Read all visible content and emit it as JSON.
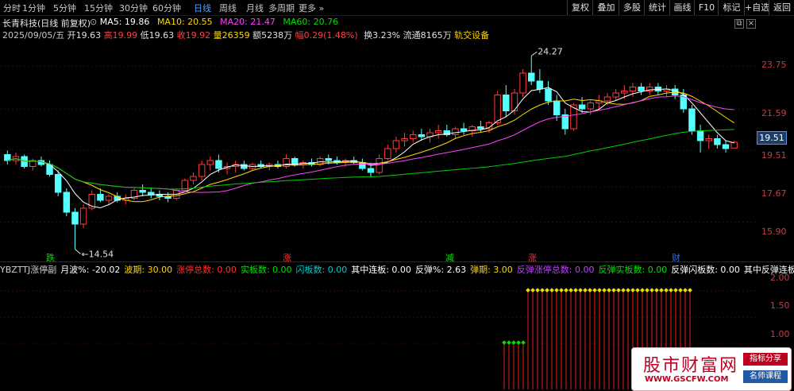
{
  "toolbar": {
    "periods": [
      "分时",
      "1分钟",
      "5分钟",
      "15分钟",
      "30分钟",
      "60分钟",
      "日线",
      "周线",
      "月线",
      "多周期",
      "更多 »"
    ],
    "active_period": "日线",
    "buttons": [
      "复权",
      "叠加",
      "多股",
      "统计",
      "画线",
      "F10",
      "标记",
      "+自选",
      "返回"
    ]
  },
  "stock": {
    "title": "长青科技(日线 前复权)",
    "ma5": "MA5: 19.86",
    "ma10": "MA10: 20.55",
    "ma20": "MA20: 21.47",
    "ma60": "MA60: 20.76",
    "date": "2025/09/05/五",
    "open": "开19.63",
    "high": "高19.99",
    "low": "低19.63",
    "close": "收19.92",
    "volume": "量26359",
    "amount": "额5238万",
    "change": "幅0.29(1.48%)",
    "turnover": "换3.23%",
    "float": "流通8165万",
    "sector": "轨交设备"
  },
  "axis": {
    "labels": [
      "23.75",
      "21.59",
      "19.51",
      "17.67",
      "15.90"
    ],
    "current_price": "19.51",
    "high_note": "24.27",
    "low_note": "14.54"
  },
  "signals": [
    "跌",
    "涨",
    "减",
    "涨",
    "财"
  ],
  "indicator": {
    "name": "YBZTTJ涨停副",
    "items": [
      {
        "label": "月波%: -20.02",
        "color": "#ffffff"
      },
      {
        "label": "波期: 30.00",
        "color": "#ffd700"
      },
      {
        "label": "涨停总数: 0.00",
        "color": "#ff3030"
      },
      {
        "label": "实板数: 0.00",
        "color": "#00e000"
      },
      {
        "label": "闪板数: 0.00",
        "color": "#00c8c8"
      },
      {
        "label": "其中连板: 0.00",
        "color": "#ffffff"
      },
      {
        "label": "反弹%: 2.63",
        "color": "#ffffff"
      },
      {
        "label": "弹期: 3.00",
        "color": "#ffd700"
      },
      {
        "label": "反弹涨停总数: 0.00",
        "color": "#c040ff"
      },
      {
        "label": "反弹实板数: 0.00",
        "color": "#00e000"
      },
      {
        "label": "反弹闪板数: 0.00",
        "color": "#ffffff"
      },
      {
        "label": "其中反弹连板:",
        "color": "#ffffff"
      }
    ],
    "axis": [
      "2.00",
      "1.50",
      "1.00"
    ]
  },
  "watermark": {
    "brand": "股市财富网",
    "url": "WWW.GSCFW.COM",
    "tag1": "指标分享",
    "tag2": "名师课程"
  },
  "chart_data": {
    "type": "candlestick",
    "ylim": [
      14.0,
      25.0
    ],
    "candles": [
      [
        19.3,
        19.5,
        18.8,
        19.0
      ],
      [
        19.0,
        19.4,
        18.8,
        19.2
      ],
      [
        19.2,
        19.3,
        18.6,
        18.7
      ],
      [
        18.7,
        19.1,
        18.5,
        19.0
      ],
      [
        19.0,
        19.2,
        18.7,
        18.8
      ],
      [
        18.8,
        19.0,
        18.2,
        18.3
      ],
      [
        18.3,
        18.5,
        17.2,
        17.4
      ],
      [
        17.4,
        17.6,
        16.2,
        16.4
      ],
      [
        16.4,
        16.6,
        14.54,
        15.8
      ],
      [
        15.8,
        16.8,
        15.6,
        16.6
      ],
      [
        16.6,
        17.5,
        16.5,
        17.3
      ],
      [
        17.3,
        17.6,
        16.9,
        17.0
      ],
      [
        17.0,
        17.3,
        16.8,
        17.2
      ],
      [
        17.2,
        17.4,
        16.9,
        17.0
      ],
      [
        17.0,
        17.3,
        16.8,
        17.1
      ],
      [
        17.1,
        17.6,
        17.0,
        17.5
      ],
      [
        17.5,
        17.8,
        17.2,
        17.4
      ],
      [
        17.4,
        17.6,
        17.1,
        17.3
      ],
      [
        17.3,
        17.5,
        17.0,
        17.2
      ],
      [
        17.2,
        17.4,
        16.9,
        17.1
      ],
      [
        17.1,
        17.6,
        17.0,
        17.5
      ],
      [
        17.5,
        18.1,
        17.4,
        18.0
      ],
      [
        18.0,
        18.4,
        17.8,
        18.2
      ],
      [
        18.2,
        19.0,
        18.0,
        18.8
      ],
      [
        18.8,
        19.2,
        18.5,
        19.0
      ],
      [
        19.0,
        19.3,
        18.4,
        18.6
      ],
      [
        18.6,
        18.9,
        18.3,
        18.7
      ],
      [
        18.7,
        19.0,
        18.4,
        18.8
      ],
      [
        18.8,
        19.0,
        18.5,
        18.6
      ],
      [
        18.6,
        18.9,
        18.5,
        18.8
      ],
      [
        18.8,
        19.0,
        18.6,
        18.7
      ],
      [
        18.7,
        18.9,
        18.5,
        18.8
      ],
      [
        18.8,
        19.0,
        18.6,
        18.7
      ],
      [
        18.7,
        19.3,
        18.6,
        19.1
      ],
      [
        19.1,
        19.2,
        18.7,
        18.8
      ],
      [
        18.8,
        19.0,
        18.6,
        18.9
      ],
      [
        18.9,
        19.1,
        18.7,
        18.8
      ],
      [
        18.8,
        19.2,
        18.7,
        19.1
      ],
      [
        19.1,
        19.3,
        18.8,
        19.0
      ],
      [
        19.0,
        19.2,
        18.8,
        18.9
      ],
      [
        18.9,
        19.1,
        18.7,
        19.0
      ],
      [
        19.0,
        19.2,
        18.8,
        18.9
      ],
      [
        18.9,
        19.1,
        18.5,
        18.6
      ],
      [
        18.6,
        18.9,
        18.2,
        18.4
      ],
      [
        18.4,
        19.3,
        18.3,
        19.1
      ],
      [
        19.1,
        19.8,
        19.0,
        19.6
      ],
      [
        19.6,
        20.2,
        19.4,
        20.0
      ],
      [
        20.0,
        20.4,
        19.7,
        20.1
      ],
      [
        20.1,
        20.5,
        19.9,
        20.3
      ],
      [
        20.3,
        20.6,
        20.0,
        20.2
      ],
      [
        20.2,
        20.6,
        19.9,
        20.4
      ],
      [
        20.4,
        20.8,
        20.1,
        20.5
      ],
      [
        20.5,
        20.8,
        20.2,
        20.3
      ],
      [
        20.3,
        20.7,
        20.1,
        20.6
      ],
      [
        20.6,
        20.9,
        20.3,
        20.5
      ],
      [
        20.5,
        20.8,
        20.2,
        20.7
      ],
      [
        20.7,
        21.0,
        20.4,
        20.6
      ],
      [
        20.6,
        21.0,
        20.4,
        20.9
      ],
      [
        20.9,
        22.5,
        20.8,
        22.3
      ],
      [
        22.3,
        22.8,
        21.2,
        21.5
      ],
      [
        21.5,
        22.6,
        21.3,
        22.4
      ],
      [
        22.4,
        23.6,
        22.2,
        23.4
      ],
      [
        23.4,
        24.27,
        22.8,
        23.0
      ],
      [
        23.0,
        23.6,
        22.4,
        22.6
      ],
      [
        22.6,
        23.0,
        21.8,
        22.0
      ],
      [
        22.0,
        22.3,
        21.0,
        21.3
      ],
      [
        21.3,
        21.6,
        20.3,
        20.6
      ],
      [
        20.6,
        21.9,
        20.5,
        21.8
      ],
      [
        21.8,
        22.2,
        21.4,
        21.6
      ],
      [
        21.6,
        22.0,
        21.3,
        21.9
      ],
      [
        21.9,
        22.3,
        21.6,
        22.0
      ],
      [
        22.0,
        22.4,
        21.8,
        22.2
      ],
      [
        22.2,
        22.6,
        22.0,
        22.4
      ],
      [
        22.4,
        22.8,
        22.1,
        22.5
      ],
      [
        22.5,
        22.9,
        22.2,
        22.7
      ],
      [
        22.7,
        22.9,
        22.3,
        22.5
      ],
      [
        22.5,
        22.9,
        22.3,
        22.7
      ],
      [
        22.7,
        22.9,
        22.3,
        22.5
      ],
      [
        22.5,
        22.8,
        22.2,
        22.6
      ],
      [
        22.6,
        22.8,
        22.1,
        22.3
      ],
      [
        22.3,
        22.6,
        21.4,
        21.6
      ],
      [
        21.6,
        21.8,
        20.3,
        20.5
      ],
      [
        20.5,
        20.8,
        19.4,
        20.0
      ],
      [
        20.0,
        20.3,
        19.6,
        20.1
      ],
      [
        20.1,
        20.3,
        19.6,
        19.8
      ],
      [
        19.8,
        20.0,
        19.4,
        19.6
      ],
      [
        19.63,
        19.99,
        19.63,
        19.92
      ]
    ]
  }
}
